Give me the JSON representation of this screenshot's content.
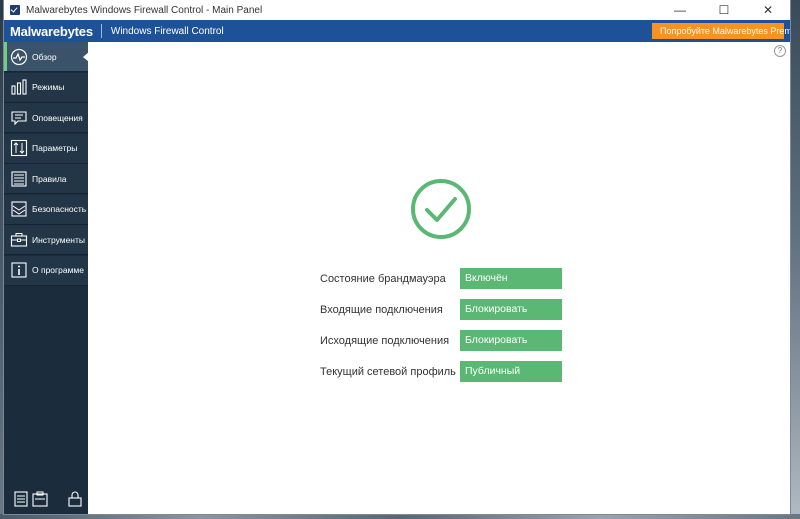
{
  "window": {
    "title": "Malwarebytes Windows Firewall Control - Main Panel",
    "controls": {
      "minimize": "—",
      "maximize": "☐",
      "close": "✕"
    }
  },
  "header": {
    "logo": "Malwarebytes",
    "product": "Windows Firewall Control",
    "premium_button": "Попробуйте Malwarebytes Premium"
  },
  "sidebar": {
    "items": [
      {
        "label": "Обзор",
        "icon": "pulse-icon",
        "active": true
      },
      {
        "label": "Режимы",
        "icon": "bars-icon",
        "active": false
      },
      {
        "label": "Оповещения",
        "icon": "message-icon",
        "active": false
      },
      {
        "label": "Параметры",
        "icon": "sliders-icon",
        "active": false
      },
      {
        "label": "Правила",
        "icon": "list-icon",
        "active": false
      },
      {
        "label": "Безопасность",
        "icon": "shield-icon",
        "active": false
      },
      {
        "label": "Инструменты",
        "icon": "toolbox-icon",
        "active": false
      },
      {
        "label": "О программе",
        "icon": "info-icon",
        "active": false
      }
    ],
    "bottom_icons": [
      "notes-icon",
      "clipboard-icon",
      "lock-icon"
    ]
  },
  "main": {
    "help": "?",
    "status_icon": "check-circle-icon",
    "rows": [
      {
        "label": "Состояние брандмауэра",
        "value": "Включён"
      },
      {
        "label": "Входящие подключения",
        "value": "Блокировать"
      },
      {
        "label": "Исходящие подключения",
        "value": "Блокировать"
      },
      {
        "label": "Текущий сетевой профиль",
        "value": "Публичный"
      }
    ]
  },
  "colors": {
    "header_blue": "#1d5299",
    "sidebar": "#1b2d3d",
    "premium_orange": "#f7931e",
    "status_green": "#5ab874"
  }
}
